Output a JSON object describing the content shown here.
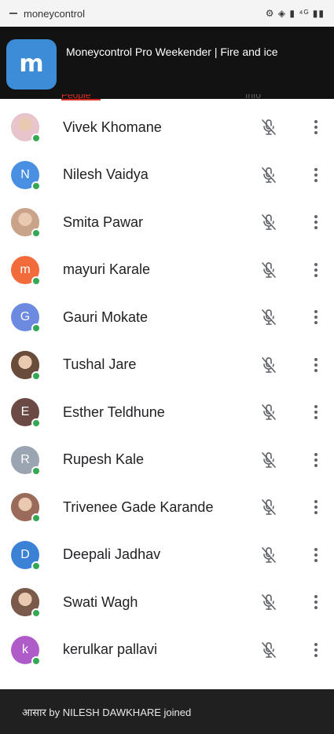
{
  "status_bar": {
    "app_name": "moneycontrol",
    "icons_text": "⚙ ◈ ▮ ⁴ᴳ ▮▮"
  },
  "banner": {
    "title": "Moneycontrol Pro Weekender | Fire and ice",
    "logo_letter": "m",
    "logo_color": "#3d8cd8"
  },
  "tabs": {
    "active": "People",
    "other": "Info"
  },
  "participants": [
    {
      "name": "Vivek Khomane",
      "initial": "",
      "color": "#e8c4cc",
      "photo": true
    },
    {
      "name": "Nilesh Vaidya",
      "initial": "N",
      "color": "#4a90e2",
      "photo": false
    },
    {
      "name": "Smita Pawar",
      "initial": "",
      "color": "#c9a48a",
      "photo": true
    },
    {
      "name": "mayuri Karale",
      "initial": "m",
      "color": "#f26b3a",
      "photo": false
    },
    {
      "name": "Gauri Mokate",
      "initial": "G",
      "color": "#6b8ae0",
      "photo": false
    },
    {
      "name": "Tushal Jare",
      "initial": "",
      "color": "#6a4c3a",
      "photo": true
    },
    {
      "name": "Esther Teldhune",
      "initial": "E",
      "color": "#6b4a45",
      "photo": false
    },
    {
      "name": "Rupesh Kale",
      "initial": "R",
      "color": "#9aa5b1",
      "photo": false
    },
    {
      "name": "Trivenee Gade Karande",
      "initial": "",
      "color": "#9a6b5a",
      "photo": true
    },
    {
      "name": "Deepali Jadhav",
      "initial": "D",
      "color": "#3b82d6",
      "photo": false
    },
    {
      "name": "Swati Wagh",
      "initial": "",
      "color": "#7a5a4a",
      "photo": true
    },
    {
      "name": "kerulkar pallavi",
      "initial": "k",
      "color": "#b05cc8",
      "photo": false
    }
  ],
  "toast": {
    "message": "आसार by NILESH DAWKHARE joined"
  }
}
